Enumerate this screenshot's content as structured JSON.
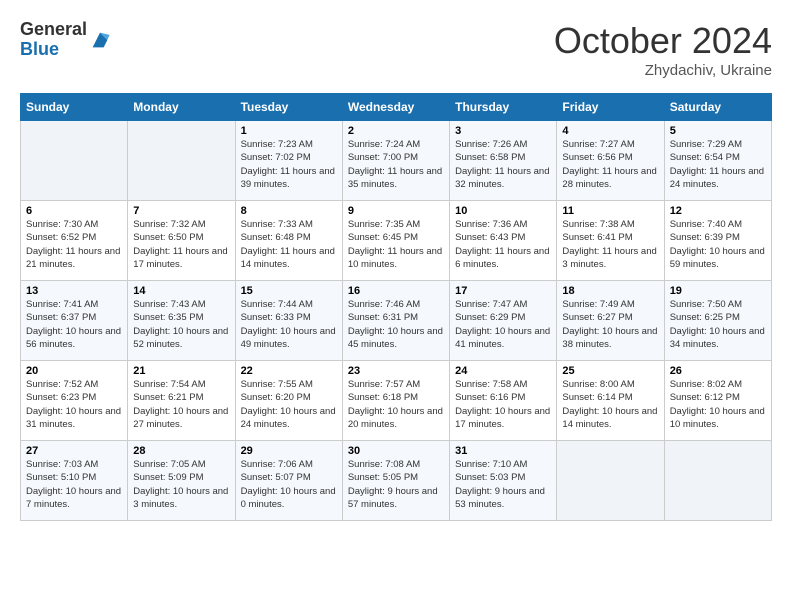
{
  "logo": {
    "line1": "General",
    "line2": "Blue"
  },
  "title": "October 2024",
  "subtitle": "Zhydachiv, Ukraine",
  "days_header": [
    "Sunday",
    "Monday",
    "Tuesday",
    "Wednesday",
    "Thursday",
    "Friday",
    "Saturday"
  ],
  "weeks": [
    [
      {
        "day": "",
        "detail": ""
      },
      {
        "day": "",
        "detail": ""
      },
      {
        "day": "1",
        "detail": "Sunrise: 7:23 AM\nSunset: 7:02 PM\nDaylight: 11 hours and 39 minutes."
      },
      {
        "day": "2",
        "detail": "Sunrise: 7:24 AM\nSunset: 7:00 PM\nDaylight: 11 hours and 35 minutes."
      },
      {
        "day": "3",
        "detail": "Sunrise: 7:26 AM\nSunset: 6:58 PM\nDaylight: 11 hours and 32 minutes."
      },
      {
        "day": "4",
        "detail": "Sunrise: 7:27 AM\nSunset: 6:56 PM\nDaylight: 11 hours and 28 minutes."
      },
      {
        "day": "5",
        "detail": "Sunrise: 7:29 AM\nSunset: 6:54 PM\nDaylight: 11 hours and 24 minutes."
      }
    ],
    [
      {
        "day": "6",
        "detail": "Sunrise: 7:30 AM\nSunset: 6:52 PM\nDaylight: 11 hours and 21 minutes."
      },
      {
        "day": "7",
        "detail": "Sunrise: 7:32 AM\nSunset: 6:50 PM\nDaylight: 11 hours and 17 minutes."
      },
      {
        "day": "8",
        "detail": "Sunrise: 7:33 AM\nSunset: 6:48 PM\nDaylight: 11 hours and 14 minutes."
      },
      {
        "day": "9",
        "detail": "Sunrise: 7:35 AM\nSunset: 6:45 PM\nDaylight: 11 hours and 10 minutes."
      },
      {
        "day": "10",
        "detail": "Sunrise: 7:36 AM\nSunset: 6:43 PM\nDaylight: 11 hours and 6 minutes."
      },
      {
        "day": "11",
        "detail": "Sunrise: 7:38 AM\nSunset: 6:41 PM\nDaylight: 11 hours and 3 minutes."
      },
      {
        "day": "12",
        "detail": "Sunrise: 7:40 AM\nSunset: 6:39 PM\nDaylight: 10 hours and 59 minutes."
      }
    ],
    [
      {
        "day": "13",
        "detail": "Sunrise: 7:41 AM\nSunset: 6:37 PM\nDaylight: 10 hours and 56 minutes."
      },
      {
        "day": "14",
        "detail": "Sunrise: 7:43 AM\nSunset: 6:35 PM\nDaylight: 10 hours and 52 minutes."
      },
      {
        "day": "15",
        "detail": "Sunrise: 7:44 AM\nSunset: 6:33 PM\nDaylight: 10 hours and 49 minutes."
      },
      {
        "day": "16",
        "detail": "Sunrise: 7:46 AM\nSunset: 6:31 PM\nDaylight: 10 hours and 45 minutes."
      },
      {
        "day": "17",
        "detail": "Sunrise: 7:47 AM\nSunset: 6:29 PM\nDaylight: 10 hours and 41 minutes."
      },
      {
        "day": "18",
        "detail": "Sunrise: 7:49 AM\nSunset: 6:27 PM\nDaylight: 10 hours and 38 minutes."
      },
      {
        "day": "19",
        "detail": "Sunrise: 7:50 AM\nSunset: 6:25 PM\nDaylight: 10 hours and 34 minutes."
      }
    ],
    [
      {
        "day": "20",
        "detail": "Sunrise: 7:52 AM\nSunset: 6:23 PM\nDaylight: 10 hours and 31 minutes."
      },
      {
        "day": "21",
        "detail": "Sunrise: 7:54 AM\nSunset: 6:21 PM\nDaylight: 10 hours and 27 minutes."
      },
      {
        "day": "22",
        "detail": "Sunrise: 7:55 AM\nSunset: 6:20 PM\nDaylight: 10 hours and 24 minutes."
      },
      {
        "day": "23",
        "detail": "Sunrise: 7:57 AM\nSunset: 6:18 PM\nDaylight: 10 hours and 20 minutes."
      },
      {
        "day": "24",
        "detail": "Sunrise: 7:58 AM\nSunset: 6:16 PM\nDaylight: 10 hours and 17 minutes."
      },
      {
        "day": "25",
        "detail": "Sunrise: 8:00 AM\nSunset: 6:14 PM\nDaylight: 10 hours and 14 minutes."
      },
      {
        "day": "26",
        "detail": "Sunrise: 8:02 AM\nSunset: 6:12 PM\nDaylight: 10 hours and 10 minutes."
      }
    ],
    [
      {
        "day": "27",
        "detail": "Sunrise: 7:03 AM\nSunset: 5:10 PM\nDaylight: 10 hours and 7 minutes."
      },
      {
        "day": "28",
        "detail": "Sunrise: 7:05 AM\nSunset: 5:09 PM\nDaylight: 10 hours and 3 minutes."
      },
      {
        "day": "29",
        "detail": "Sunrise: 7:06 AM\nSunset: 5:07 PM\nDaylight: 10 hours and 0 minutes."
      },
      {
        "day": "30",
        "detail": "Sunrise: 7:08 AM\nSunset: 5:05 PM\nDaylight: 9 hours and 57 minutes."
      },
      {
        "day": "31",
        "detail": "Sunrise: 7:10 AM\nSunset: 5:03 PM\nDaylight: 9 hours and 53 minutes."
      },
      {
        "day": "",
        "detail": ""
      },
      {
        "day": "",
        "detail": ""
      }
    ]
  ]
}
